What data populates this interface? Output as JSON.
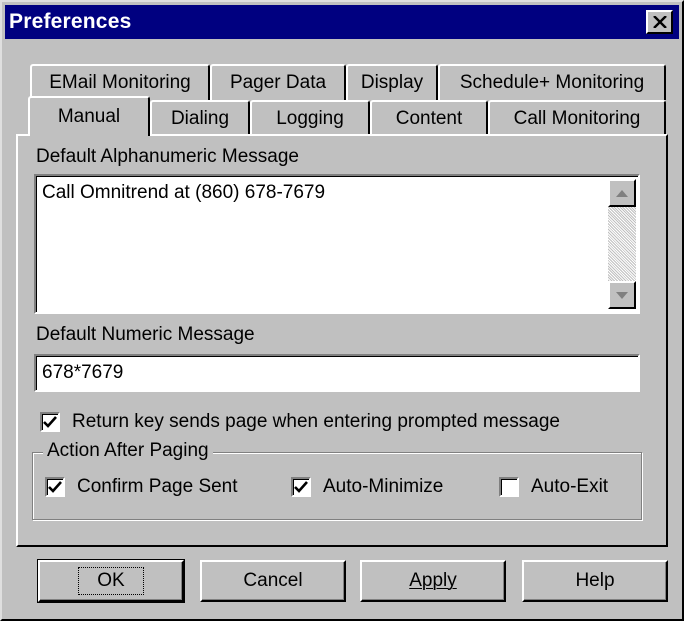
{
  "window": {
    "title": "Preferences"
  },
  "tabs": {
    "back_row": [
      "EMail Monitoring",
      "Pager Data",
      "Display",
      "Schedule+ Monitoring"
    ],
    "front_row": [
      "Manual",
      "Dialing",
      "Logging",
      "Content",
      "Call Monitoring"
    ],
    "active": "Manual"
  },
  "manual": {
    "alpha_label": "Default Alphanumeric Message",
    "alpha_value": "Call Omnitrend at (860) 678-7679",
    "numeric_label": "Default Numeric Message",
    "numeric_value": "678*7679",
    "return_key_label": "Return key sends page when entering prompted message",
    "return_key_checked": true,
    "group_title": "Action After Paging",
    "confirm_label": "Confirm Page Sent",
    "confirm_checked": true,
    "minimize_label": "Auto-Minimize",
    "minimize_checked": true,
    "exit_label": "Auto-Exit",
    "exit_checked": false
  },
  "buttons": {
    "ok": "OK",
    "cancel": "Cancel",
    "apply": "Apply",
    "help": "Help"
  },
  "colors": {
    "titlebar": "#000080",
    "face": "#c0c0c0"
  }
}
